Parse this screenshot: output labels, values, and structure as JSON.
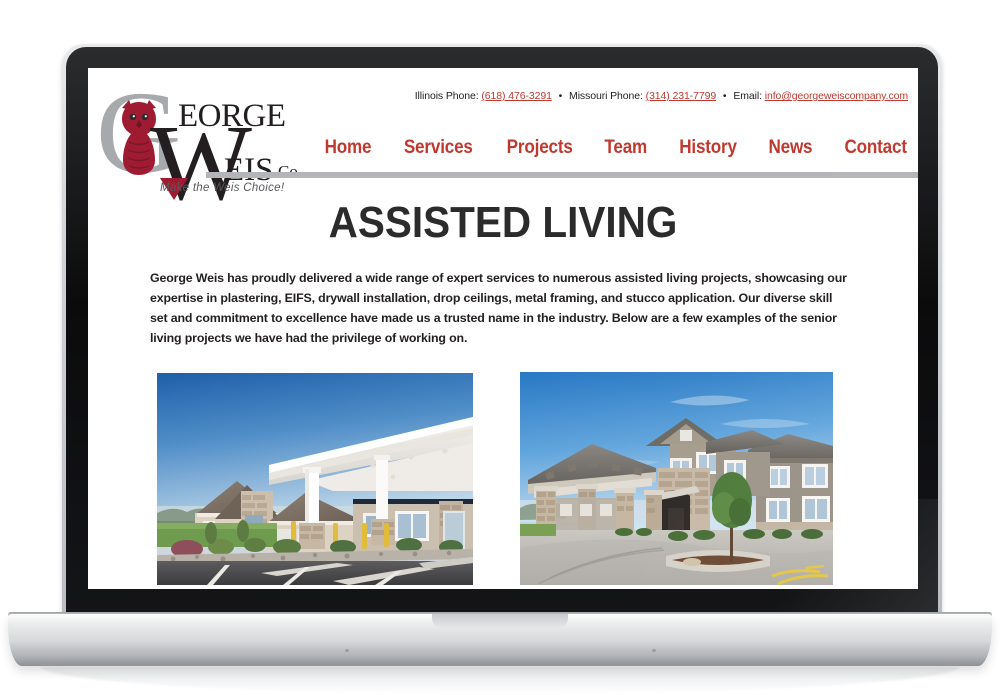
{
  "device": {
    "type": "laptop-mockup"
  },
  "site": {
    "logo": {
      "letter_g": "G",
      "word_eorge": "EORGE",
      "letter_w": "W",
      "word_eis": "EIS",
      "suffix": "Co.",
      "tagline": "Make the Weis Choice!",
      "owl_color": "#9e1b32",
      "g_color": "#a7a9ac"
    },
    "contact": {
      "illinois_label": "Illinois Phone:",
      "illinois_phone": "(618) 476-3291",
      "missouri_label": "Missouri Phone:",
      "missouri_phone": "(314) 231-7799",
      "email_label": "Email:",
      "email": "info@georgeweiscompany.com",
      "separator": "•",
      "link_color": "#c0392f"
    },
    "nav": {
      "items": [
        {
          "label": "Home"
        },
        {
          "label": "Services"
        },
        {
          "label": "Projects"
        },
        {
          "label": "Team"
        },
        {
          "label": "History"
        },
        {
          "label": "News"
        },
        {
          "label": "Contact"
        }
      ],
      "accent_color": "#c0392f"
    },
    "main": {
      "page_title": "ASSISTED LIVING",
      "intro_paragraph": "George Weis has proudly delivered a wide range of expert services to numerous assisted living projects, showcasing our expertise in plastering, EIFS, drywall installation, drop ceilings, metal framing, and stucco application. Our diverse skill set and commitment to excellence have made us a trusted name in the industry. Below are a few examples of the senior living projects we have had the privilege of working on.",
      "gallery": [
        {
          "name": "single-story-assisted-living-entrance",
          "alt": "Single-story assisted living facility with white covered entry portico, stone accents and parking lot"
        },
        {
          "name": "two-story-senior-living-porte-cochere",
          "alt": "Two-story senior living community with stone columned porte-cochere and curved driveway"
        }
      ]
    }
  }
}
